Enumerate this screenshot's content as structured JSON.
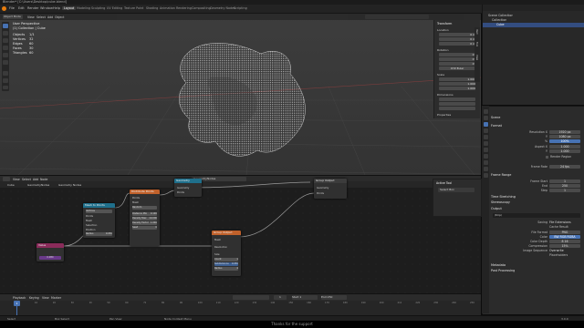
{
  "window": {
    "title": "Blender* [C:\\Users\\Desktop\\cube.blend]"
  },
  "menu": {
    "items": [
      "File",
      "Edit",
      "Render",
      "Window",
      "Help"
    ],
    "workspaces": [
      "Layout",
      "Modeling",
      "Sculpting",
      "UV Editing",
      "Texture Paint",
      "Shading",
      "Animation",
      "Rendering",
      "Compositing",
      "Geometry Nodes",
      "Scripting"
    ],
    "active_workspace": "Layout",
    "scene": "Scene",
    "view_layer": "ViewLayer"
  },
  "viewport": {
    "mode": "Object Mode",
    "menus": [
      "View",
      "Select",
      "Add",
      "Object"
    ],
    "info": {
      "line1": "User Perspective",
      "line2": "(1) Collection | Cube",
      "objects_label": "Objects",
      "objects_value": "1/1",
      "vertices_label": "Vertices",
      "vertices_value": "32",
      "edges_label": "Edges",
      "edges_value": "60",
      "faces_label": "Faces",
      "faces_value": "30",
      "triangles_label": "Triangles",
      "triangles_value": "60"
    },
    "npanel": {
      "header": "Transform",
      "location": "Location",
      "rotation": "Rotation",
      "scale": "Scale",
      "mode": "XYZ Euler",
      "dimensions": "Dimensions",
      "values": [
        "0 m",
        "0 m",
        "0 m",
        "0°",
        "0°",
        "0°",
        "1.000",
        "1.000",
        "1.000"
      ],
      "properties": "Properties",
      "tabs": [
        "Item",
        "Tool",
        "View"
      ]
    }
  },
  "outliner": {
    "title": "Scene Collection",
    "items": [
      "Collection",
      "Cube"
    ]
  },
  "properties": {
    "context": "Scene",
    "format_section": "Format",
    "rows": [
      {
        "label": "Resolution X",
        "value": "1920 px"
      },
      {
        "label": "Y",
        "value": "1080 px"
      },
      {
        "label": "%",
        "value": "100%",
        "blue": true
      },
      {
        "label": "Aspect X",
        "value": "1.000"
      },
      {
        "label": "Y",
        "value": "1.000"
      },
      {
        "label": "Render Region",
        "value": ""
      },
      {
        "label": "Frame Rate",
        "value": "24 fps"
      }
    ],
    "frame_range": "Frame Range",
    "frame_rows": [
      {
        "label": "Frame Start",
        "value": "1"
      },
      {
        "label": "End",
        "value": "250"
      },
      {
        "label": "Step",
        "value": "1"
      }
    ],
    "sections": [
      "Time Stretching",
      "Stereoscopy",
      "Output"
    ],
    "output_path": "/tmp/",
    "output_rows": [
      {
        "label": "Saving",
        "value": "File Extensions"
      },
      {
        "label": "",
        "value": "Cache Result"
      },
      {
        "label": "File Format",
        "value": "PNG"
      },
      {
        "label": "Color",
        "value": "BW  RGB  RGBA",
        "blue": true
      },
      {
        "label": "Color Depth",
        "value": "8  16"
      },
      {
        "label": "Compression",
        "value": "15%"
      },
      {
        "label": "Image Sequence",
        "value": "Overwrite"
      },
      {
        "label": "",
        "value": "Placeholders"
      }
    ],
    "bottom_sections": [
      "Metadata",
      "Post Processing"
    ]
  },
  "node_editor": {
    "header_menus": [
      "View",
      "Select",
      "Add",
      "Node"
    ],
    "editor_name": "GeometryNodes",
    "breadcrumb": [
      "Cube",
      "GeometryNodes",
      "Geometry Nodes"
    ],
    "side_panel": {
      "title": "Active Tool",
      "item": "Select Box"
    },
    "nodes": {
      "group_input": "Group Input",
      "group_output": "Group Output",
      "mesh_to_points": "Mesh to Points",
      "distribute": "Distribute Points",
      "value": "Value",
      "value_number": "0.080",
      "mtp_mode": "Vertices",
      "mtp_rows": [
        "Points",
        "Mesh",
        "Selection",
        "Position",
        "Radius"
      ],
      "mtp_radius": "0.050",
      "dist_rows": [
        "Points",
        "Mesh",
        "Random",
        "Distance Min",
        "Density Max",
        "Density Factor",
        "Seed"
      ],
      "dist_vals": [
        "0.100",
        "10.000",
        "1.000",
        "0"
      ],
      "fill_rows": [
        "Mesh",
        "Resolution",
        "Size",
        "Count",
        "Subdivisions",
        "Radius"
      ],
      "fill_vals": [
        "1",
        "0.050",
        "4"
      ],
      "output_rows": [
        "Geometry",
        "Points"
      ]
    }
  },
  "timeline": {
    "menus": [
      "Playback",
      "Keying",
      "View",
      "Marker"
    ],
    "current_frame": "1",
    "start_label": "Start",
    "start_value": "1",
    "end_label": "End",
    "end_value": "250",
    "ticks": [
      "0",
      "10",
      "20",
      "30",
      "40",
      "50",
      "60",
      "70",
      "80",
      "90",
      "100",
      "110",
      "120",
      "130",
      "140",
      "150",
      "160",
      "170",
      "180",
      "190",
      "200",
      "210",
      "220",
      "230",
      "240",
      "250"
    ]
  },
  "statusbar": {
    "select": "Select",
    "box": "Box Select",
    "pan": "Pan View",
    "context": "Node Context Menu",
    "version": "3.0.0"
  },
  "caption": "Thanks for the support",
  "colors": {
    "accent": "#4772b3",
    "active_frame": "#4772b3",
    "node_geometry_header": "#1f6f8b",
    "node_mesh_header": "#c0612b",
    "node_input_header": "#8a2b5a",
    "node_group_header": "#3c3c3c"
  }
}
